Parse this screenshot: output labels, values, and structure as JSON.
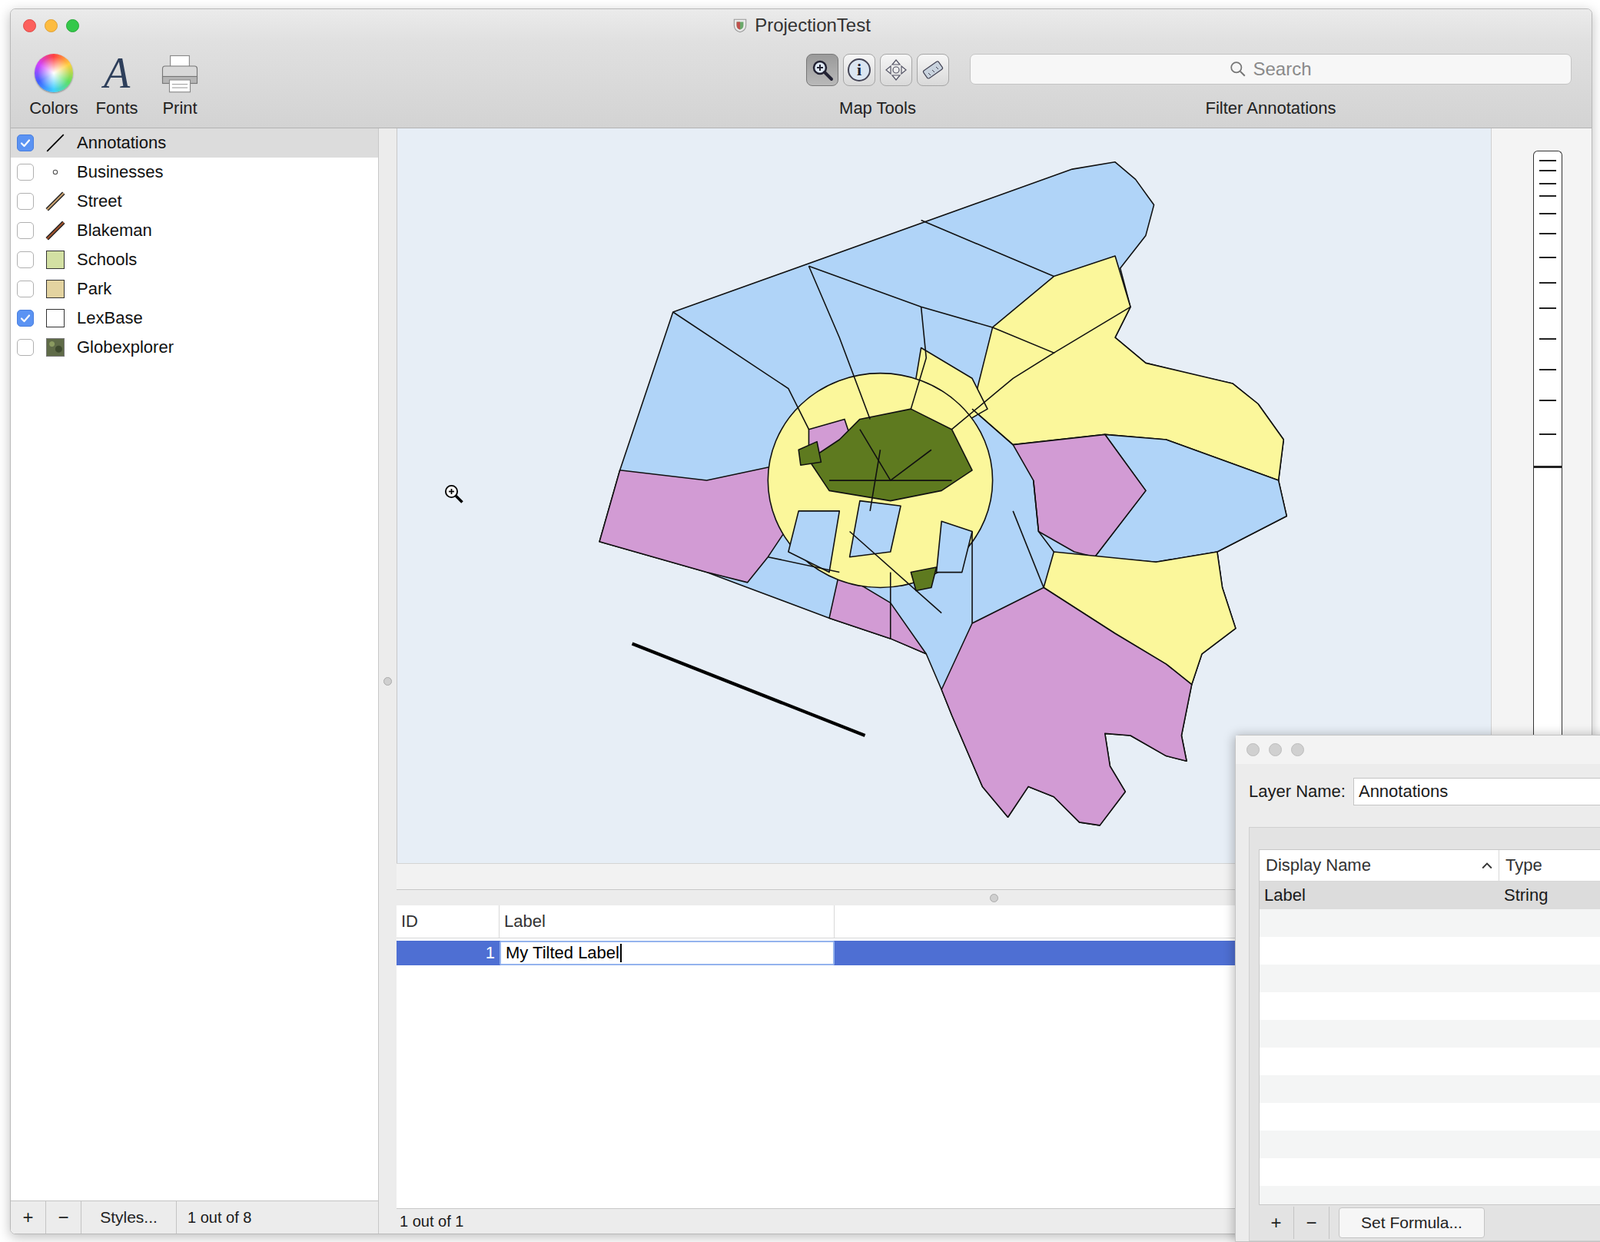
{
  "window": {
    "title": "ProjectionTest"
  },
  "toolbar": {
    "buttons": [
      {
        "label": "Colors",
        "kind": "colors"
      },
      {
        "label": "Fonts",
        "kind": "fonts",
        "glyph": "A"
      },
      {
        "label": "Print",
        "kind": "print"
      }
    ],
    "map_tools": {
      "label": "Map Tools",
      "tools": [
        {
          "kind": "zoom",
          "selected": true
        },
        {
          "kind": "info",
          "glyph": "i",
          "selected": false
        },
        {
          "kind": "pan",
          "selected": false
        },
        {
          "kind": "measure",
          "selected": false
        }
      ]
    },
    "search": {
      "placeholder": "Search",
      "label": "Filter Annotations"
    }
  },
  "layers": {
    "items": [
      {
        "name": "Annotations",
        "checked": true,
        "selected": true,
        "kind": "line",
        "color": "#000000"
      },
      {
        "name": "Businesses",
        "checked": false,
        "selected": false,
        "kind": "point",
        "color": "#555555"
      },
      {
        "name": "Street",
        "checked": false,
        "selected": false,
        "kind": "road",
        "color": "#c8a070"
      },
      {
        "name": "Blakeman",
        "checked": false,
        "selected": false,
        "kind": "road",
        "color": "#a0522d"
      },
      {
        "name": "Schools",
        "checked": false,
        "selected": false,
        "kind": "fill",
        "color": "#d3e0a3"
      },
      {
        "name": "Park",
        "checked": false,
        "selected": false,
        "kind": "fill",
        "color": "#e3d3a0"
      },
      {
        "name": "LexBase",
        "checked": true,
        "selected": false,
        "kind": "fill",
        "color": "#ffffff"
      },
      {
        "name": "Globexplorer",
        "checked": false,
        "selected": false,
        "kind": "image",
        "color": "#5f6b48"
      }
    ],
    "footer": {
      "add": "+",
      "remove": "−",
      "styles": "Styles...",
      "count": "1 out of 8"
    }
  },
  "table": {
    "columns": [
      "ID",
      "Label"
    ],
    "rows": [
      {
        "id": "1",
        "label": "My Tilted Label",
        "selected": true,
        "editing": true
      }
    ],
    "status": "1 out of 1"
  },
  "panel": {
    "layer_name_label": "Layer Name:",
    "layer_name": "Annotations",
    "columns": [
      {
        "label": "Display Name",
        "sorted": true
      },
      {
        "label": "Type",
        "sorted": false
      }
    ],
    "rows": [
      {
        "name": "Label",
        "type": "String",
        "selected": true
      }
    ],
    "buttons": [
      "+",
      "−",
      "Set Formula..."
    ]
  }
}
